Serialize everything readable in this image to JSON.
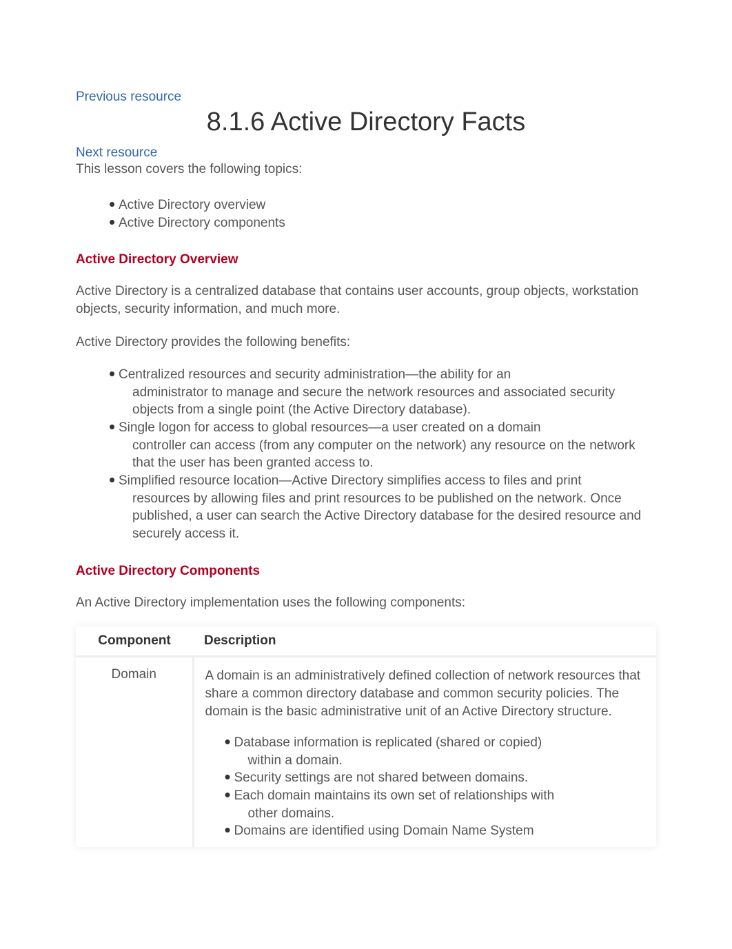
{
  "nav": {
    "previous": "Previous resource",
    "next": "Next resource"
  },
  "title": "8.1.6 Active Directory Facts",
  "intro": "This lesson covers the following topics:",
  "topics": [
    "Active Directory overview",
    "Active Directory components"
  ],
  "section1": {
    "heading": "Active Directory Overview",
    "para1": "Active Directory is a centralized database that contains user accounts, group objects, workstation objects, security information, and much more.",
    "para2": "Active Directory provides the following benefits:",
    "benefits": [
      {
        "first": "Centralized resources and security administration—the ability for an",
        "rest": "administrator to manage and secure the network resources and associated security objects from a single point (the Active Directory database)."
      },
      {
        "first": "Single logon for access to global resources—a user created on a domain",
        "rest": "controller can access (from any computer on the network) any resource on the network that the user has been granted access to."
      },
      {
        "first": "Simplified resource location—Active Directory simplifies access to files and print",
        "rest": "resources by allowing files and print resources to be published on the network. Once published, a user can search the Active Directory database for the desired resource and securely access it."
      }
    ]
  },
  "section2": {
    "heading": "Active Directory Components",
    "para1": "An Active Directory implementation uses the following components:",
    "table": {
      "headers": [
        "Component",
        "Description"
      ],
      "rows": [
        {
          "component": "Domain",
          "para": "A domain is an administratively defined collection of network resources that share a common directory database and common security policies. The domain is the basic administrative unit of an Active Directory structure.",
          "bullets": [
            {
              "first": "Database information is replicated (shared or copied)",
              "rest": "within a domain."
            },
            {
              "first": "Security settings are not shared between domains.",
              "rest": ""
            },
            {
              "first": "Each domain maintains its own set of relationships with",
              "rest": "other domains."
            },
            {
              "first": "Domains are identified using Domain Name System",
              "rest": ""
            }
          ]
        }
      ]
    }
  }
}
